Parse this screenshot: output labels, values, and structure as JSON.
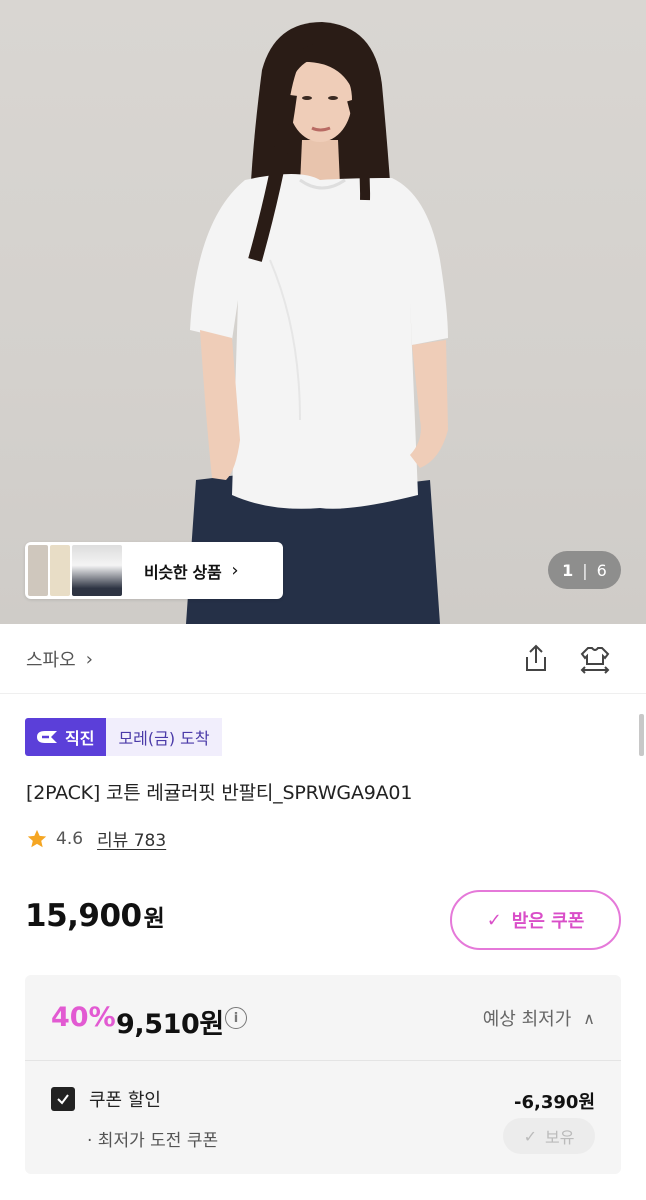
{
  "hero": {
    "similar_label": "비슷한 상품",
    "counter_current": "1",
    "counter_total": "6"
  },
  "brand": {
    "name": "스파오"
  },
  "badges": {
    "direct": "직진",
    "arrival": "모레(금) 도착"
  },
  "product": {
    "title": "[2PACK] 코튼 레귤러핏 반팔티_SPRWGA9A01",
    "rating": "4.6",
    "review_label": "리뷰 783",
    "price": "15,900",
    "price_unit": "원"
  },
  "coupon": {
    "button_label": "받은 쿠폰"
  },
  "discount": {
    "percent": "40%",
    "final_price": "9,510원",
    "expected_label": "예상 최저가",
    "coupon_discount_label": "쿠폰 할인",
    "coupon_discount_amount": "-6,390원",
    "challenge_label": "· 최저가 도전 쿠폰",
    "hold_label": "보유"
  },
  "colors": {
    "accent_purple": "#5b3fd9",
    "accent_pink": "#e25ad2",
    "star": "#f5a623"
  }
}
